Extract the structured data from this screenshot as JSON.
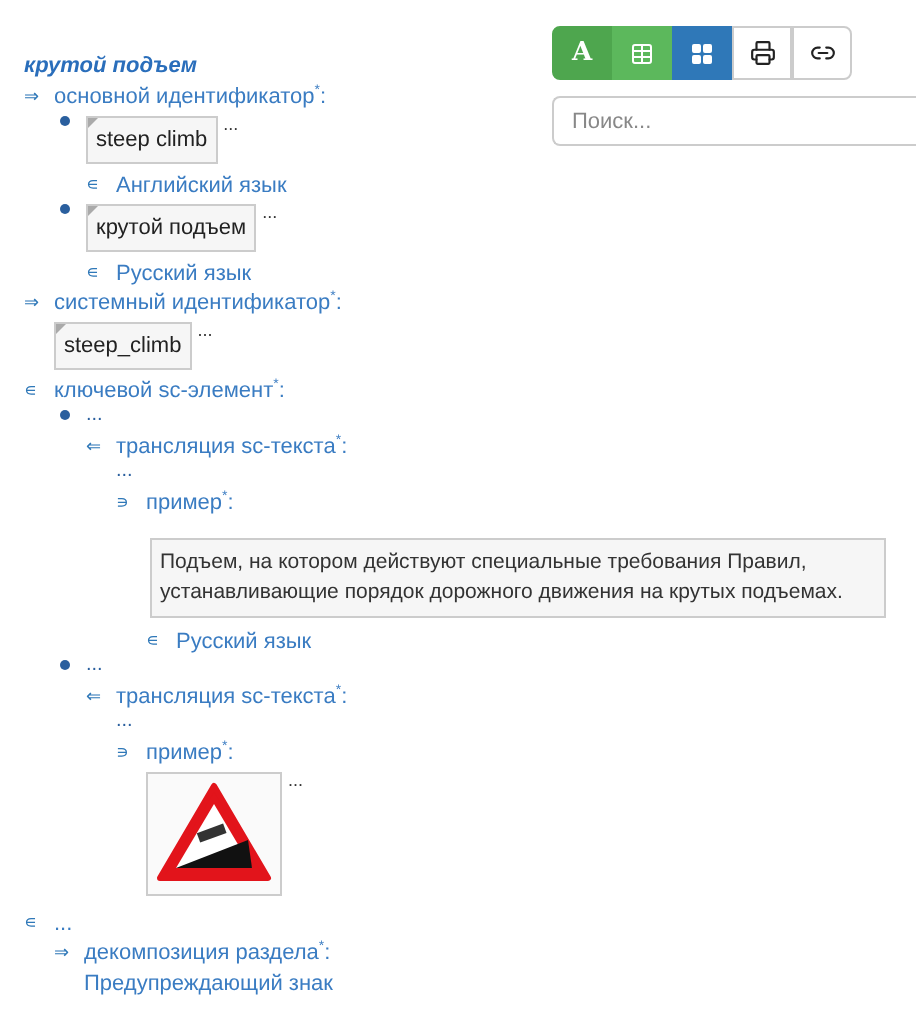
{
  "toolbar": [
    {
      "kind": "letter",
      "label": "A",
      "color": "#4ea64e"
    },
    {
      "kind": "table",
      "color": "#5cb85c"
    },
    {
      "kind": "grid",
      "color": "#2f78b8"
    },
    {
      "kind": "print",
      "color": "#ffffff"
    },
    {
      "kind": "link",
      "color": "#ffffff"
    }
  ],
  "search": {
    "placeholder": "Поиск..."
  },
  "title": "крутой подъем",
  "tree": [
    {
      "kind": "relation",
      "symbol": "⇒",
      "label": "основной идентификатор$^{*}$:",
      "children": [
        {
          "kind": "bullet",
          "children": [
            {
              "kind": "field",
              "text": "steep climb",
              "more": "..."
            },
            {
              "kind": "relation",
              "symbol": "∊",
              "label": "Английский язык"
            }
          ]
        },
        {
          "kind": "bullet",
          "children": [
            {
              "kind": "field",
              "text": "крутой подъем",
              "more": "..."
            },
            {
              "kind": "relation",
              "symbol": "∊",
              "label": "Русский язык"
            }
          ]
        }
      ]
    },
    {
      "kind": "relation",
      "symbol": "⇒",
      "label": "системный идентификатор$^{*}$:",
      "children": [
        {
          "kind": "field",
          "text": "steep_climb",
          "more": "..."
        }
      ]
    },
    {
      "kind": "relation",
      "symbol": "∊",
      "label": "ключевой sc-элемент$^{*}$:",
      "children": [
        {
          "kind": "bullet",
          "children": [
            {
              "kind": "ellipsis",
              "text": "..."
            },
            {
              "kind": "relation",
              "symbol": "⇐",
              "label": "трансляция sc-текста$^{*}$:",
              "children": [
                {
                  "kind": "ellipsis",
                  "text": "..."
                },
                {
                  "kind": "relation",
                  "symbol": "∍",
                  "label": "пример$^{*}$:",
                  "children": [
                    {
                      "kind": "text",
                      "text": "Подъем, на котором действуют специальные требования Правил, устанавливающие порядок дорожного движения на крутых подъемах."
                    },
                    {
                      "kind": "relation",
                      "symbol": "∊",
                      "label": "Русский язык"
                    }
                  ]
                }
              ]
            }
          ]
        },
        {
          "kind": "bullet",
          "children": [
            {
              "kind": "ellipsis",
              "text": "..."
            },
            {
              "kind": "relation",
              "symbol": "⇐",
              "label": "трансляция sc-текста$^{*}$:",
              "children": [
                {
                  "kind": "ellipsis",
                  "text": "..."
                },
                {
                  "kind": "relation",
                  "symbol": "∍",
                  "label": "пример$^{*}$:",
                  "children": [
                    {
                      "more": "..."
                    }
                  ]
                }
              ]
            }
          ]
        }
      ]
    },
    {
      "kind": "relation",
      "symbol": "∊",
      "label": "...",
      "children": [
        {
          "kind": "relation",
          "symbol": "⇒",
          "label": "декомпозиция раздела$^{*}$:",
          "children": [
            {
              "kind": "link",
              "text": "Предупреждающий знак"
            }
          ]
        }
      ]
    }
  ]
}
